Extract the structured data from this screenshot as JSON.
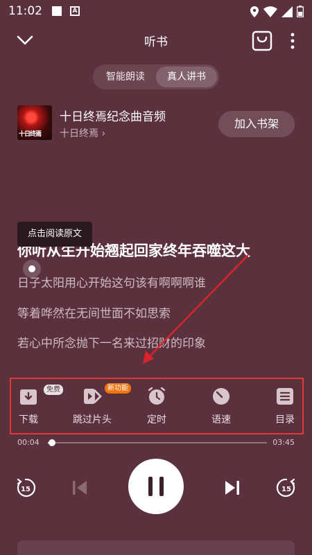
{
  "status": {
    "time": "11:02"
  },
  "header": {
    "title": "听书"
  },
  "mode_toggle": [
    {
      "label": "智能朗读",
      "active": false
    },
    {
      "label": "真人讲书",
      "active": true
    }
  ],
  "book": {
    "cover_text": "十日终焉",
    "title": "十日终焉纪念曲音频",
    "author": "十日终焉",
    "add_shelf": "加入书架"
  },
  "tooltip": "点击阅读原文",
  "lyrics": {
    "current": "你听从生开始翘起回家终年吞噬这大",
    "line2": "日子太阳用心开始这句该有啊啊啊谁",
    "line3": "等着哗然在无间世面不如思索",
    "line4": "若心中所念抛下一名来过招财的印象"
  },
  "toolbar": {
    "download": "下载",
    "download_badge": "免费",
    "skip_intro": "跳过片头",
    "skip_badge": "新功能",
    "timer": "定时",
    "speed": "语速",
    "catalog": "目录"
  },
  "progress": {
    "current": "00:04",
    "total": "03:45",
    "fraction": 0.018
  },
  "controls": {
    "rewind_seconds": "15",
    "forward_seconds": "15"
  },
  "colors": {
    "background": "#5b313e",
    "highlight_box": "#e53935",
    "new_badge": "#f0740e"
  }
}
